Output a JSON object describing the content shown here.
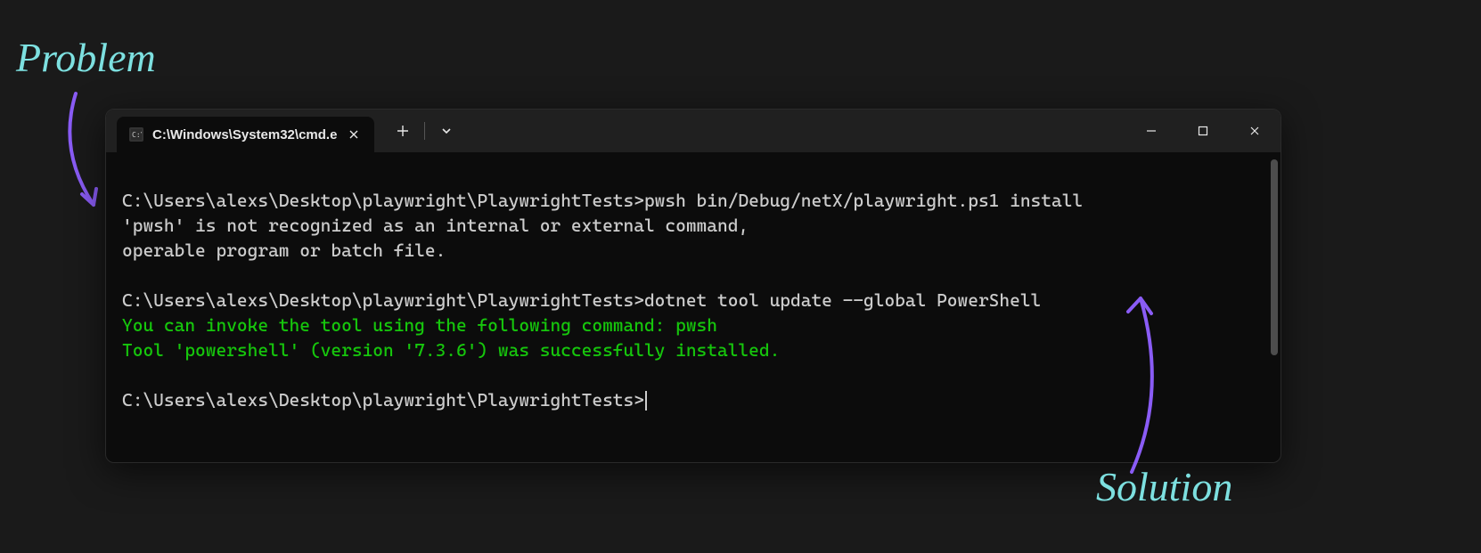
{
  "annotations": {
    "problem": "Problem",
    "solution": "Solution"
  },
  "window": {
    "tab": {
      "title": "C:\\Windows\\System32\\cmd.e",
      "icon_name": "cmd-icon"
    },
    "controls": {
      "new_tab_tooltip": "New Tab",
      "dropdown_tooltip": "Choose shell"
    }
  },
  "terminal": {
    "prompt": "C:\\Users\\alexs\\Desktop\\playwright\\PlaywrightTests>",
    "cmd1": "pwsh bin/Debug/netX/playwright.ps1 install",
    "err1": "'pwsh' is not recognized as an internal or external command,",
    "err2": "operable program or batch file.",
    "cmd2": "dotnet tool update --global PowerShell",
    "ok1": "You can invoke the tool using the following command: pwsh",
    "ok2": "Tool 'powershell' (version '7.3.6') was successfully installed."
  }
}
